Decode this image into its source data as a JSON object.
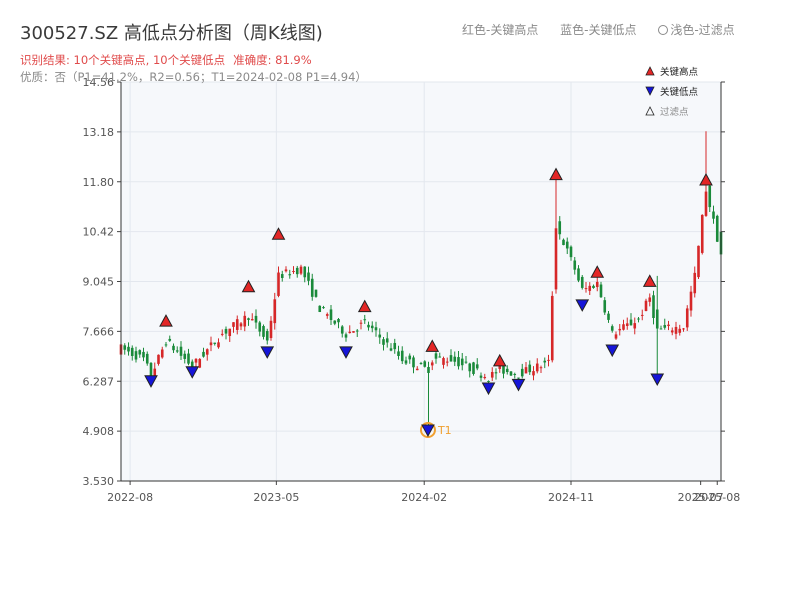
{
  "header": {
    "title": "300527.SZ 高低点分析图（周K线图)",
    "legend_red": "红色-关键高点",
    "legend_blue": "蓝色-关键低点",
    "legend_filtered": "浅色-过滤点",
    "result_text": "识别结果: 10个关键高点, 10个关键低点",
    "accuracy_text": "准确度: 81.9%",
    "quality_text": "优质：否（P1=41.2%，R2=0.56；T1=2024-02-08 P1=4.94）"
  },
  "colors": {
    "up": "#d62728",
    "down": "#1a8a3a",
    "high_marker": "#e32626",
    "low_marker": "#1515d8",
    "t1_ring": "#f0a030",
    "grid": "#e3e7ee",
    "plot_bg": "#f6f8fb"
  },
  "chart_data": {
    "type": "candlestick",
    "yticks": [
      "3.530",
      "4.908",
      "6.287",
      "7.666",
      "9.045",
      "10.42",
      "11.80",
      "13.18",
      "14.56"
    ],
    "ylim": [
      3.53,
      14.56
    ],
    "xticks": [
      "2022-08",
      "2023-05",
      "2024-02",
      "2024-11",
      "2025-07",
      "2025-08"
    ],
    "x_range": [
      "2022-07-15",
      "2025-08-08"
    ],
    "legend": [
      "关键高点",
      "关键低点",
      "过滤点"
    ],
    "t1_label": "T1",
    "t1_point": {
      "date": "2024-02-08",
      "value": 4.94
    },
    "key_highs": [
      {
        "date": "2022-10-07",
        "value": 7.95
      },
      {
        "date": "2023-03-10",
        "value": 8.9
      },
      {
        "date": "2023-05-05",
        "value": 10.35
      },
      {
        "date": "2023-10-13",
        "value": 8.35
      },
      {
        "date": "2024-02-16",
        "value": 7.25
      },
      {
        "date": "2024-06-21",
        "value": 6.85
      },
      {
        "date": "2024-10-04",
        "value": 12.0
      },
      {
        "date": "2024-12-20",
        "value": 9.3
      },
      {
        "date": "2025-03-28",
        "value": 9.05
      },
      {
        "date": "2025-07-11",
        "value": 11.85
      }
    ],
    "key_lows": [
      {
        "date": "2022-09-09",
        "value": 6.3
      },
      {
        "date": "2022-11-25",
        "value": 6.55
      },
      {
        "date": "2023-04-14",
        "value": 7.1
      },
      {
        "date": "2023-09-08",
        "value": 7.1
      },
      {
        "date": "2024-02-08",
        "value": 4.94
      },
      {
        "date": "2024-05-31",
        "value": 6.1
      },
      {
        "date": "2024-07-26",
        "value": 6.2
      },
      {
        "date": "2024-11-22",
        "value": 8.4
      },
      {
        "date": "2025-01-17",
        "value": 7.15
      },
      {
        "date": "2025-04-11",
        "value": 6.35
      }
    ],
    "anchors": [
      [
        "2022-07-15",
        7.2
      ],
      [
        "2022-08-26",
        6.9
      ],
      [
        "2022-09-09",
        6.45
      ],
      [
        "2022-10-07",
        7.4
      ],
      [
        "2022-11-25",
        6.7
      ],
      [
        "2023-01-20",
        7.6
      ],
      [
        "2023-03-10",
        8.1
      ],
      [
        "2023-04-14",
        7.4
      ],
      [
        "2023-05-05",
        9.2
      ],
      [
        "2023-06-16",
        9.4
      ],
      [
        "2023-07-21",
        8.3
      ],
      [
        "2023-09-08",
        7.6
      ],
      [
        "2023-10-13",
        7.9
      ],
      [
        "2023-12-22",
        6.9
      ],
      [
        "2024-02-08",
        6.6
      ],
      [
        "2024-02-16",
        6.9
      ],
      [
        "2024-03-22",
        6.9
      ],
      [
        "2024-05-31",
        6.4
      ],
      [
        "2024-06-21",
        6.6
      ],
      [
        "2024-07-26",
        6.5
      ],
      [
        "2024-09-20",
        6.8
      ],
      [
        "2024-10-04",
        10.6
      ],
      [
        "2024-11-08",
        9.4
      ],
      [
        "2024-11-22",
        8.8
      ],
      [
        "2024-12-20",
        9.0
      ],
      [
        "2025-01-17",
        7.6
      ],
      [
        "2025-03-07",
        8.0
      ],
      [
        "2025-03-28",
        8.6
      ],
      [
        "2025-04-11",
        7.7
      ],
      [
        "2025-05-30",
        7.8
      ],
      [
        "2025-06-20",
        9.2
      ],
      [
        "2025-07-11",
        11.6
      ],
      [
        "2025-08-08",
        9.8
      ]
    ],
    "spikes": [
      {
        "date": "2024-02-08",
        "low": 4.94
      },
      {
        "date": "2024-10-04",
        "high": 12.0
      },
      {
        "date": "2025-04-11",
        "high": 9.2,
        "low": 6.35
      },
      {
        "date": "2025-07-11",
        "high": 13.2
      }
    ]
  }
}
